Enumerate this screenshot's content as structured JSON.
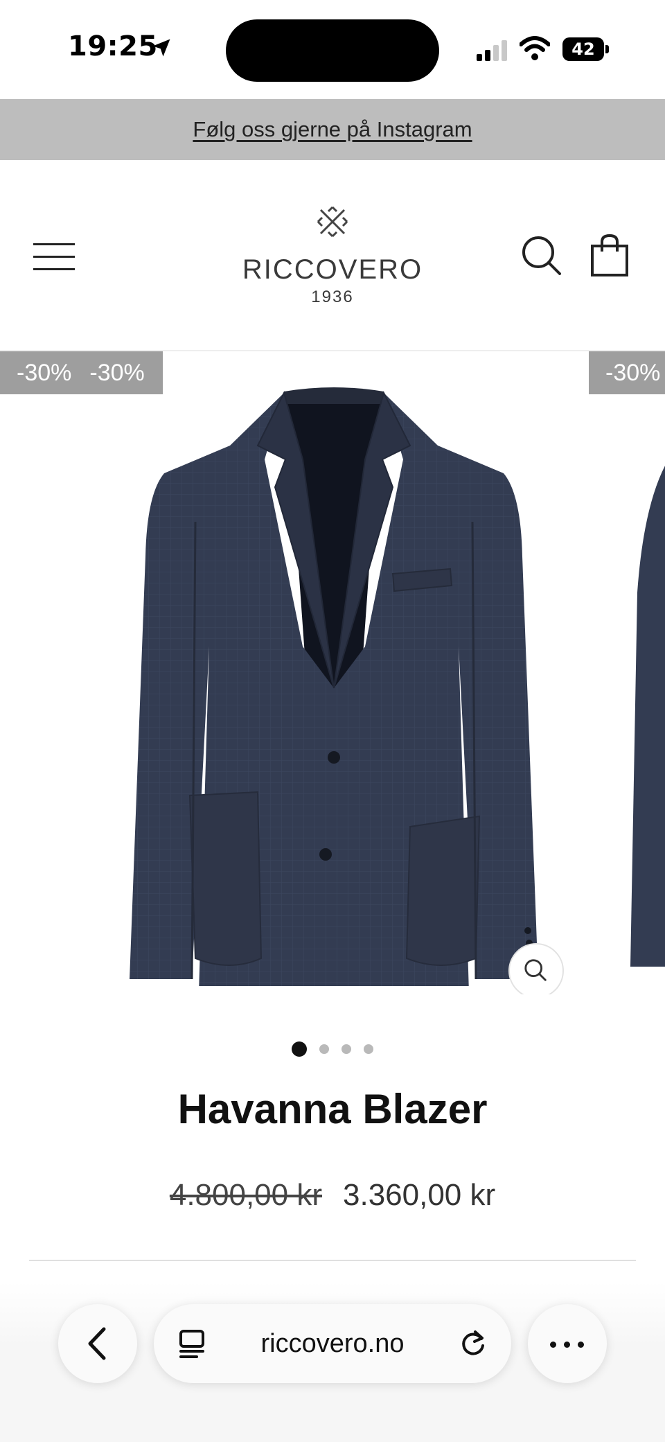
{
  "status_bar": {
    "time": "19:25",
    "battery": "42",
    "icons": [
      "location-arrow-icon",
      "signal-icon",
      "wifi-icon",
      "battery-icon"
    ]
  },
  "announcement": {
    "text": "Følg oss gjerne på Instagram"
  },
  "header": {
    "brand_name": "RICCOVERO",
    "brand_year": "1936",
    "icons": [
      "menu-icon",
      "logo-mark-icon",
      "search-icon",
      "shopping-bag-icon"
    ]
  },
  "gallery": {
    "badges": [
      "-30%",
      "-30%"
    ],
    "next_badge": "-30%",
    "image_subject": "navy blazer",
    "slide_count": 4,
    "active_slide": 1,
    "colors": {
      "blazer": "#333c52",
      "badge_bg": "#9e9e9e"
    }
  },
  "product": {
    "title": "Havanna Blazer",
    "old_price": "4.800,00 kr",
    "sale_price": "3.360,00 kr"
  },
  "browser": {
    "url": "riccovero.no",
    "icons": [
      "back-chevron-icon",
      "tabs-icon",
      "reload-icon",
      "more-dots-icon"
    ]
  }
}
